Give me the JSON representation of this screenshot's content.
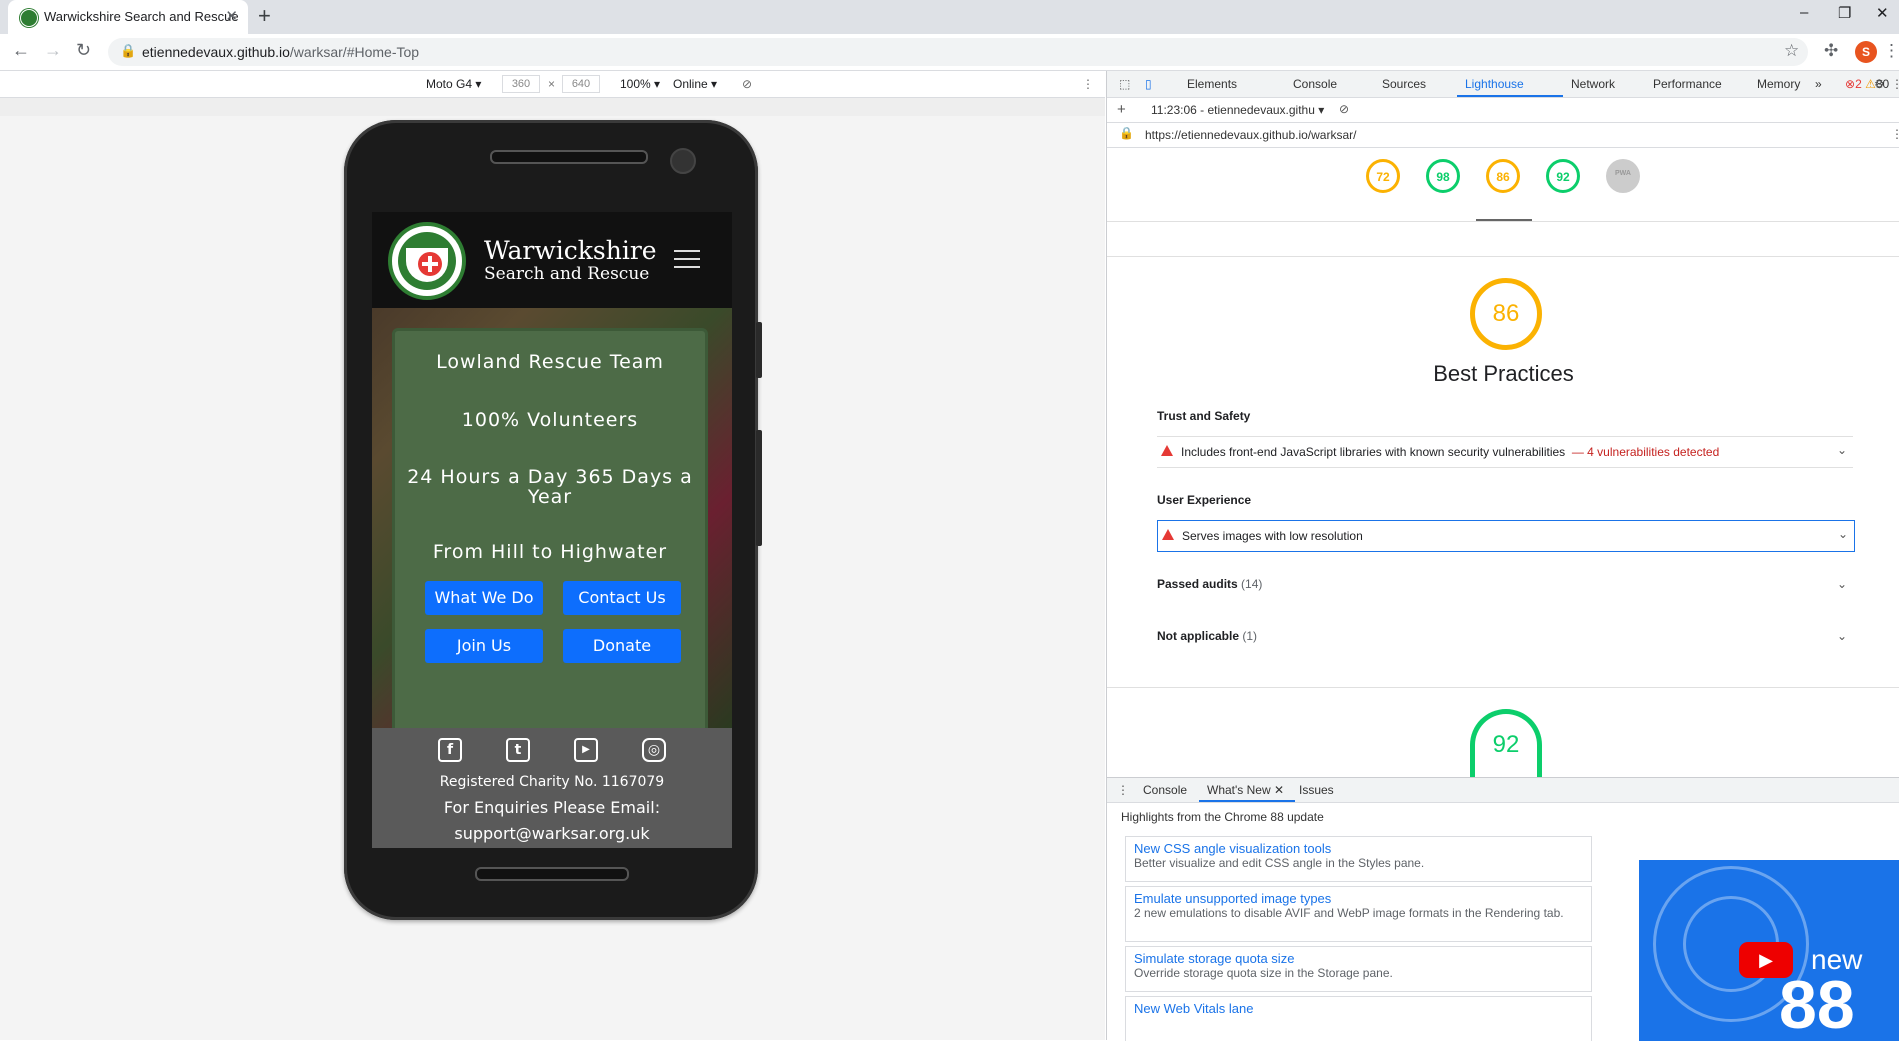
{
  "browser": {
    "tab_title": "Warwickshire Search and Rescue",
    "tab_close": "✕",
    "new_tab": "+",
    "win_min": "–",
    "win_max": "❐",
    "win_close": "✕",
    "url_host": "etiennedevaux.github.io",
    "url_path": "/warksar/#Home-Top",
    "profile_initial": "S"
  },
  "device_toolbar": {
    "device": "Moto G4 ▾",
    "width": "360",
    "x": "×",
    "height": "640",
    "zoom": "100% ▾",
    "network": "Online ▾"
  },
  "site": {
    "title": "Warwickshire",
    "subtitle": "Search and Rescue",
    "hero_lines": [
      "Lowland Rescue Team",
      "100% Volunteers",
      "24 Hours a Day 365 Days a Year",
      "From Hill to Highwater"
    ],
    "buttons": [
      "What We Do",
      "Contact Us",
      "Join Us",
      "Donate"
    ],
    "social": [
      "f",
      "t",
      "▶",
      "◎"
    ],
    "charity": "Registered Charity No. 1167079",
    "enquiries": "For Enquiries Please Email:",
    "email": "support@warksar.org.uk"
  },
  "devtools": {
    "tabs": [
      "Elements",
      "Console",
      "Sources",
      "Lighthouse",
      "Network",
      "Performance",
      "Memory",
      "»"
    ],
    "active_tab": "Lighthouse",
    "errors": "2",
    "warnings": "80",
    "report_time": "11:23:06 - etiennedevaux.githu ▾",
    "report_url": "https://etiennedevaux.github.io/warksar/",
    "scores": [
      "72",
      "98",
      "86",
      "92",
      "PWA"
    ],
    "big_score": "86",
    "category": "Best Practices",
    "trust_heading": "Trust and Safety",
    "trust_audit": "Includes front-end JavaScript libraries with known security vulnerabilities",
    "trust_audit_detail": "— 4 vulnerabilities detected",
    "ux_heading": "User Experience",
    "ux_audit": "Serves images with low resolution",
    "passed_label": "Passed audits",
    "passed_count": "(14)",
    "na_label": "Not applicable",
    "na_count": "(1)",
    "next_score": "92"
  },
  "drawer": {
    "tabs": [
      "Console",
      "What's New",
      "Issues"
    ],
    "heading": "Highlights from the Chrome 88 update",
    "cards": [
      {
        "title": "New CSS angle visualization tools",
        "desc": "Better visualize and edit CSS angle in the Styles pane."
      },
      {
        "title": "Emulate unsupported image types",
        "desc": "2 new emulations to disable AVIF and WebP image formats in the Rendering tab."
      },
      {
        "title": "Simulate storage quota size",
        "desc": "Override storage quota size in the Storage pane."
      },
      {
        "title": "New Web Vitals lane",
        "desc": ""
      }
    ],
    "video_new": "new",
    "video_num": "88"
  },
  "colors": {
    "accent": "#1a73e8",
    "orange": "#fbb202",
    "green": "#0cce6b",
    "site_button": "#0d6efd",
    "error": "#e53935"
  }
}
